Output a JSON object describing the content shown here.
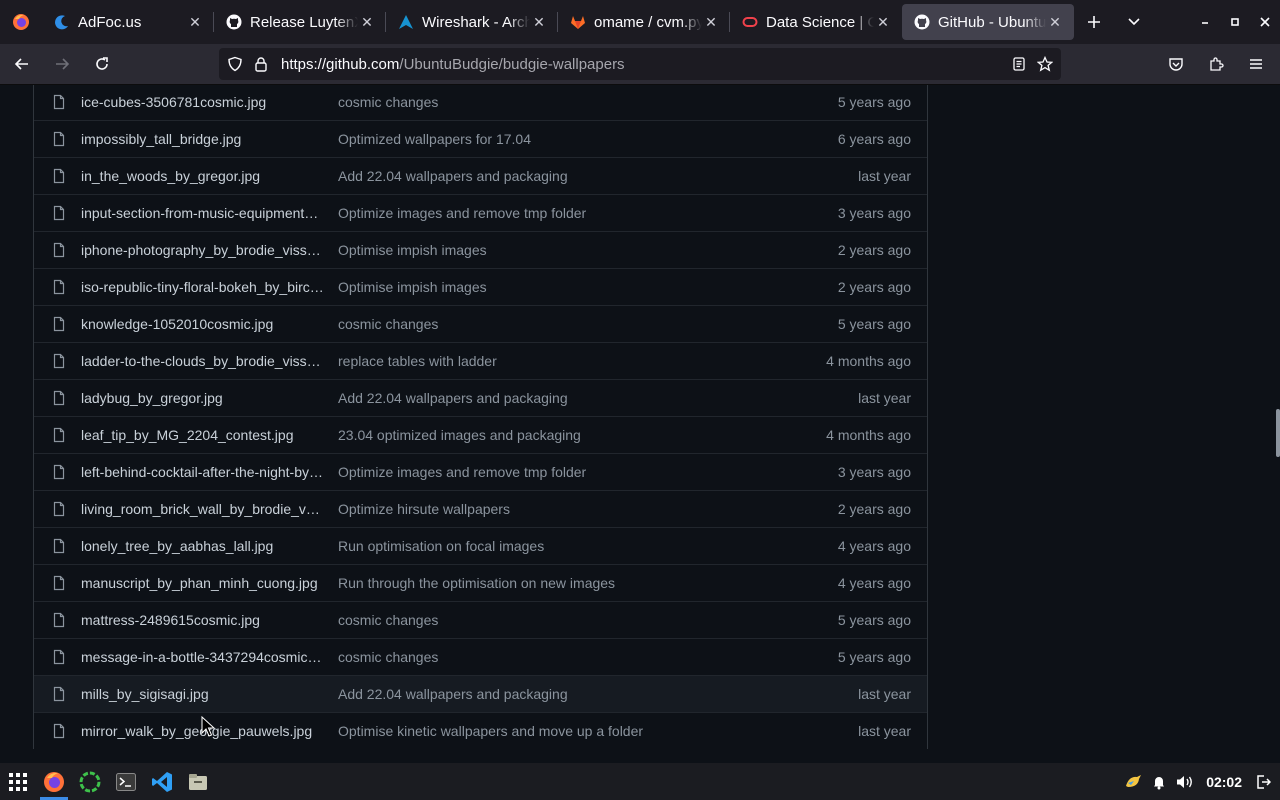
{
  "browser": {
    "tabs": [
      {
        "title": "AdFoc.us",
        "icon": "adfocus-icon",
        "active": false
      },
      {
        "title": "Release LuytenX",
        "icon": "github-icon",
        "active": false
      },
      {
        "title": "Wireshark - Arch",
        "icon": "archlinux-icon",
        "active": false
      },
      {
        "title": "omame / cvm.py",
        "icon": "gitlab-icon",
        "active": false
      },
      {
        "title": "Data Science | Or",
        "icon": "oracle-icon",
        "active": false
      },
      {
        "title": "GitHub - Ubuntu",
        "icon": "github-icon",
        "active": true
      }
    ],
    "url_host": "https://github.com",
    "url_path": "/UbuntuBudgie/budgie-wallpapers"
  },
  "files": [
    {
      "name": "ice-cubes-3506781cosmic.jpg",
      "message": "cosmic changes",
      "age": "5 years ago"
    },
    {
      "name": "impossibly_tall_bridge.jpg",
      "message": "Optimized wallpapers for 17.04",
      "age": "6 years ago"
    },
    {
      "name": "in_the_woods_by_gregor.jpg",
      "message": "Add 22.04 wallpapers and packaging",
      "age": "last year"
    },
    {
      "name": "input-section-from-music-equipment…",
      "message": "Optimize images and remove tmp folder",
      "age": "3 years ago"
    },
    {
      "name": "iphone-photography_by_brodie_viss…",
      "message": "Optimise impish images",
      "age": "2 years ago"
    },
    {
      "name": "iso-republic-tiny-floral-bokeh_by_birc…",
      "message": "Optimise impish images",
      "age": "2 years ago"
    },
    {
      "name": "knowledge-1052010cosmic.jpg",
      "message": "cosmic changes",
      "age": "5 years ago"
    },
    {
      "name": "ladder-to-the-clouds_by_brodie_viss…",
      "message": "replace tables with ladder",
      "age": "4 months ago"
    },
    {
      "name": "ladybug_by_gregor.jpg",
      "message": "Add 22.04 wallpapers and packaging",
      "age": "last year"
    },
    {
      "name": "leaf_tip_by_MG_2204_contest.jpg",
      "message": "23.04 optimized images and packaging",
      "age": "4 months ago"
    },
    {
      "name": "left-behind-cocktail-after-the-night-by…",
      "message": "Optimize images and remove tmp folder",
      "age": "3 years ago"
    },
    {
      "name": "living_room_brick_wall_by_brodie_v…",
      "message": "Optimize hirsute wallpapers",
      "age": "2 years ago"
    },
    {
      "name": "lonely_tree_by_aabhas_lall.jpg",
      "message": "Run optimisation on focal images",
      "age": "4 years ago"
    },
    {
      "name": "manuscript_by_phan_minh_cuong.jpg",
      "message": "Run through the optimisation on new images",
      "age": "4 years ago"
    },
    {
      "name": "mattress-2489615cosmic.jpg",
      "message": "cosmic changes",
      "age": "5 years ago"
    },
    {
      "name": "message-in-a-bottle-3437294cosmic…",
      "message": "cosmic changes",
      "age": "5 years ago"
    },
    {
      "name": "mills_by_sigisagi.jpg",
      "message": "Add 22.04 wallpapers and packaging",
      "age": "last year"
    },
    {
      "name": "mirror_walk_by_georgie_pauwels.jpg",
      "message": "Optimise kinetic wallpapers and move up a folder",
      "age": "last year"
    }
  ],
  "taskbar": {
    "clock": "02:02",
    "apps": [
      "apps-grid-icon",
      "firefox-icon",
      "budgie-icon",
      "terminal-icon",
      "vscode-icon",
      "files-icon"
    ]
  },
  "colors": {
    "page_bg": "#0d1117",
    "row_border": "#21262d",
    "link_text": "#c9d1d9",
    "muted_text": "#8b949e"
  }
}
